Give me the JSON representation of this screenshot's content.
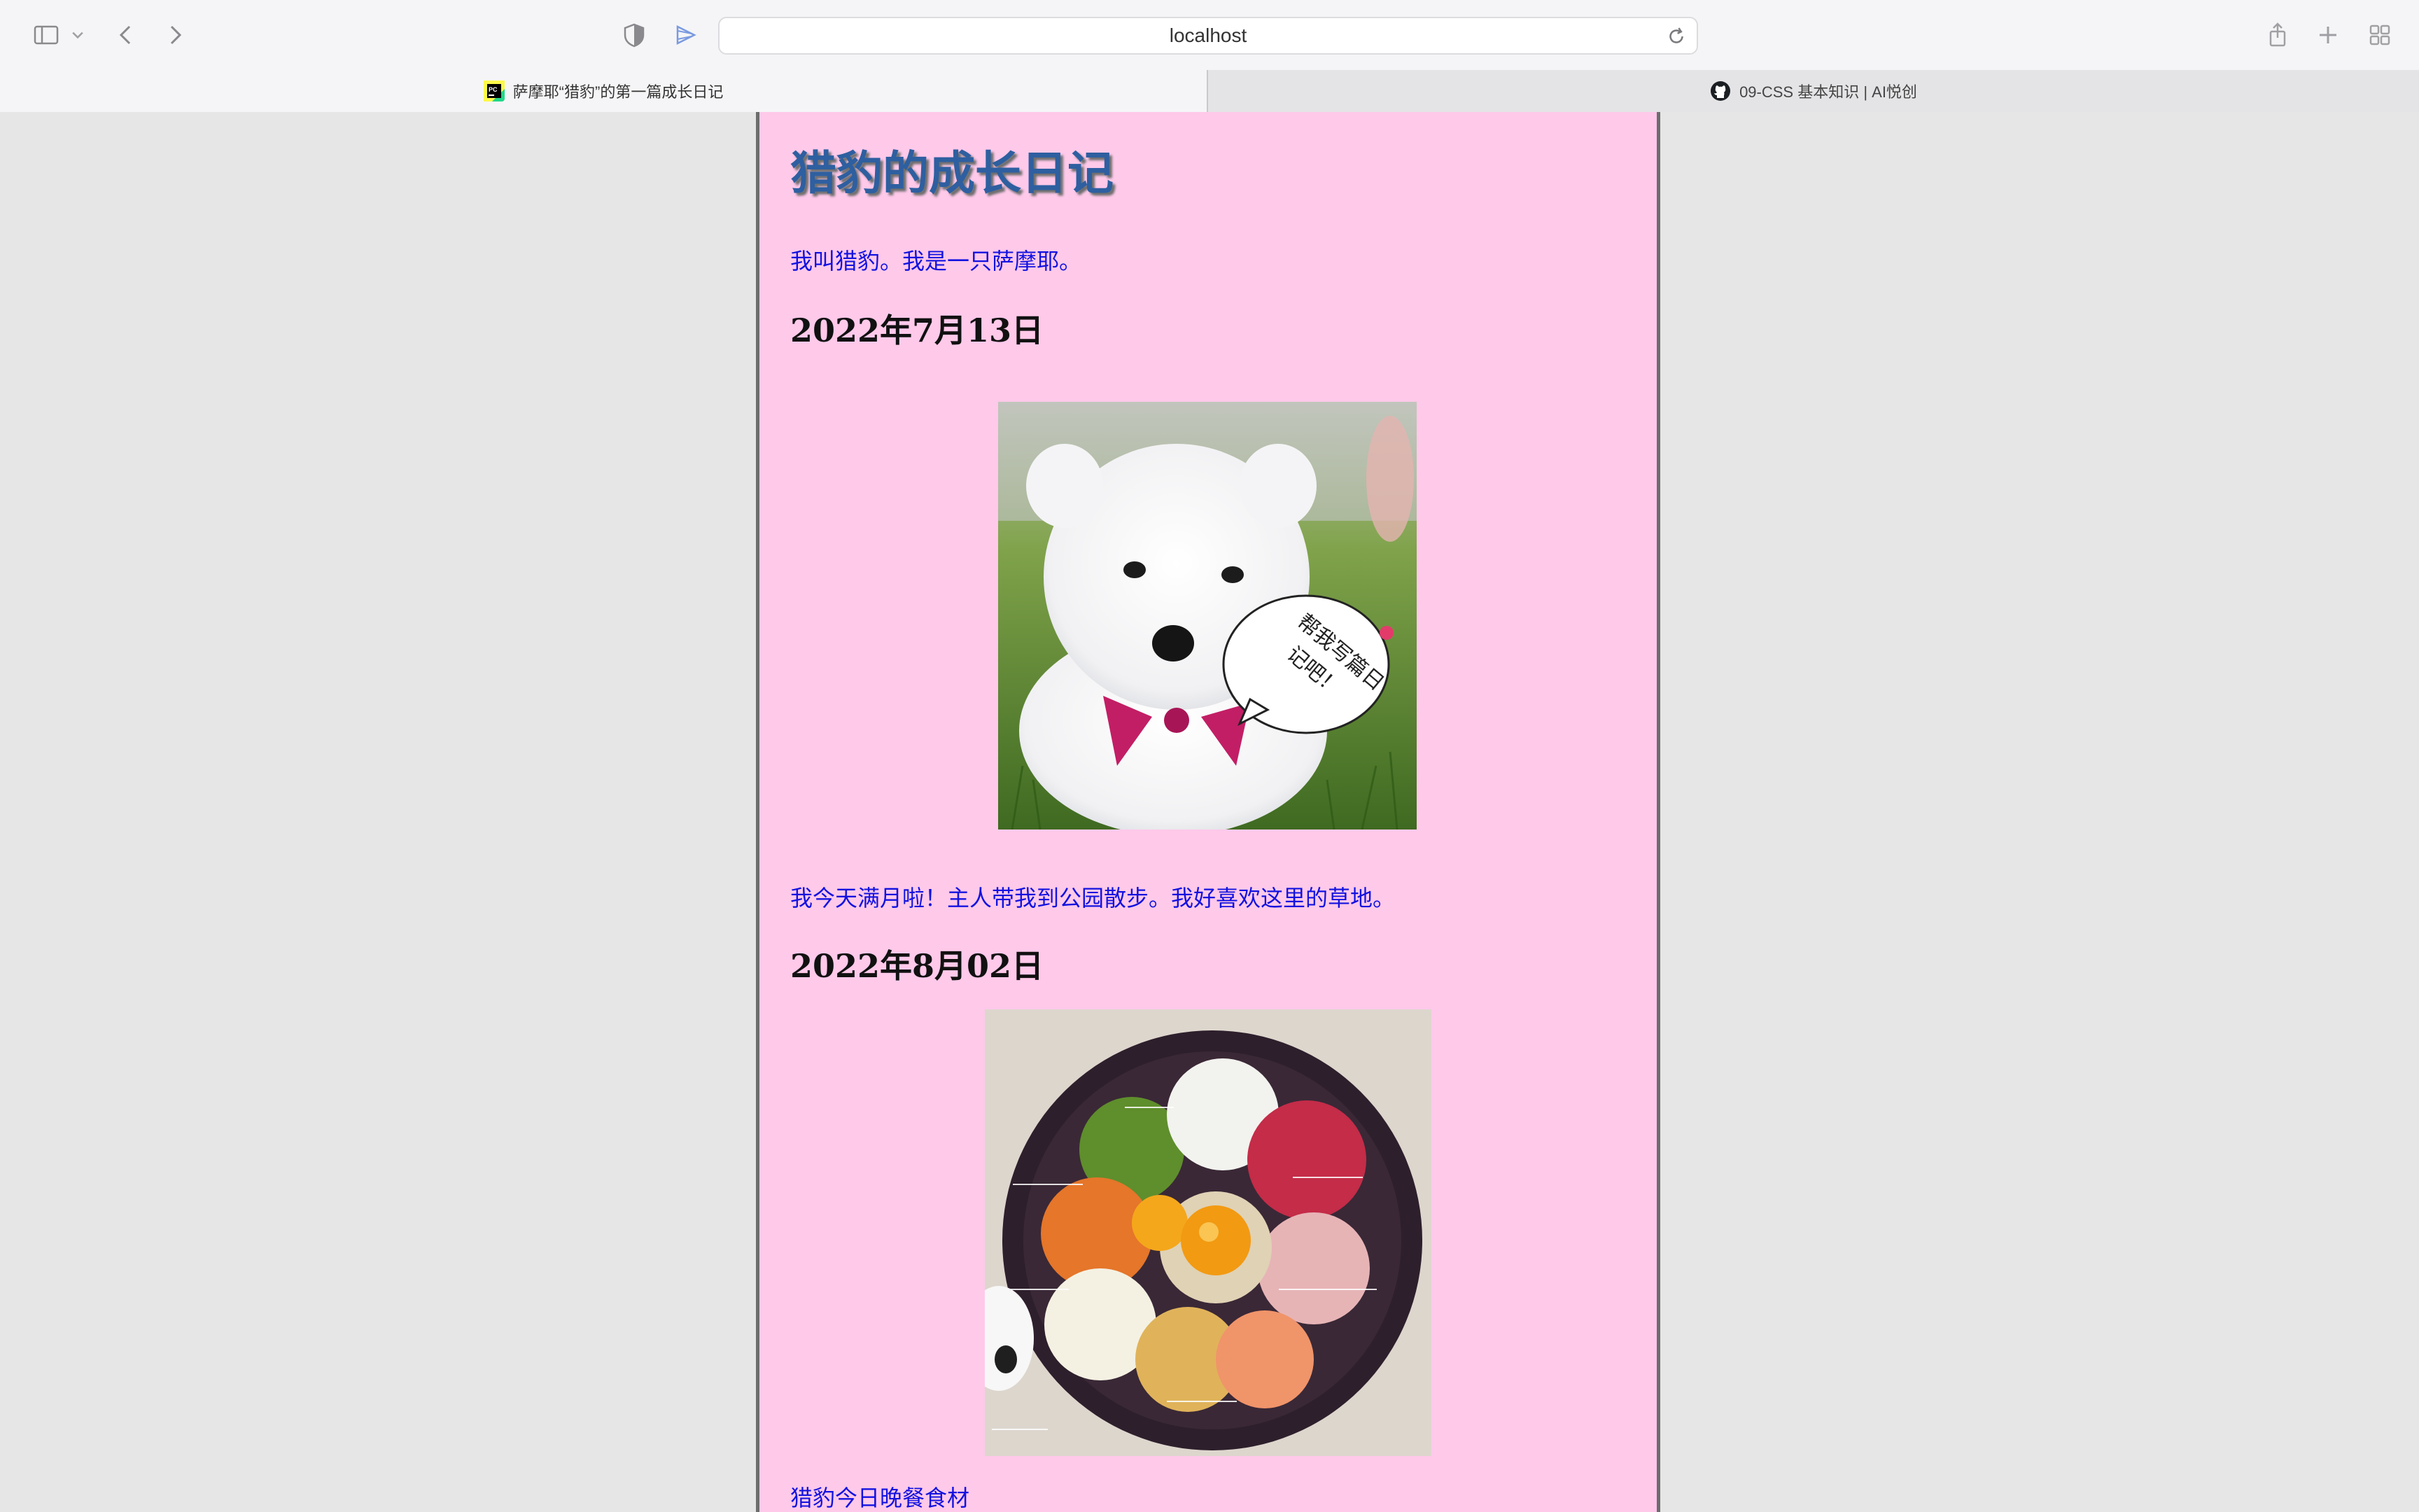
{
  "browser": {
    "url": "localhost",
    "tabs": [
      {
        "label": "萨摩耶“猎豹”的第一篇成长日记",
        "active": true
      },
      {
        "label": "09-CSS 基本知识 | AI悦创",
        "active": false
      }
    ]
  },
  "page": {
    "title": "猎豹的成长日记",
    "intro": "我叫猎豹。我是一只萨摩耶。",
    "entries": [
      {
        "date": "2022年7月13日",
        "image_speech": [
          "帮我写篇日",
          "记吧！"
        ],
        "text": "我今天满月啦！主人带我到公园散步。我好喜欢这里的草地。"
      },
      {
        "date": "2022年8月02日",
        "text": "猎豹今日晚餐食材"
      }
    ]
  },
  "colors": {
    "page_bg": "#ffc9ea",
    "title": "#2e5fa0",
    "paragraph": "#1212e0",
    "side_bg": "#e6e6e6"
  }
}
